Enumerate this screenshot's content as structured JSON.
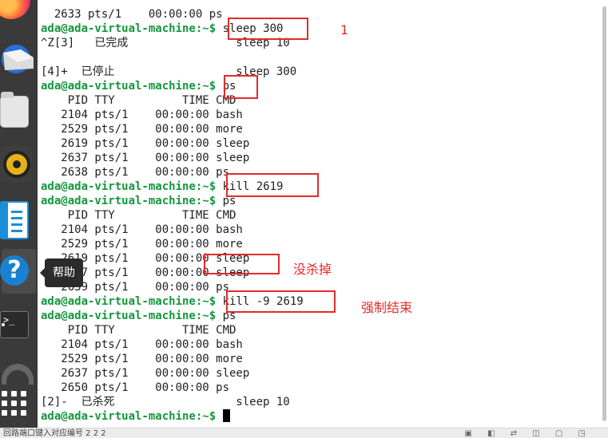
{
  "dock": {
    "tooltip": "帮助",
    "terminal_icon": ">_",
    "icons": [
      "firefox-icon",
      "thunderbird-mail-icon",
      "files-icon",
      "rhythmbox-icon",
      "libreoffice-writer-icon",
      "help-icon",
      "terminal-icon",
      "software-icon",
      "show-applications-icon"
    ]
  },
  "terminal": {
    "prompt": "ada@ada-virtual-machine:~$",
    "lines": [
      {
        "text": "  2633 pts/1    00:00:00 ps"
      },
      {
        "prompt": true,
        "text": " sleep 300"
      },
      {
        "text": "^Z[3]   已完成                sleep 10"
      },
      {
        "text": ""
      },
      {
        "text": "[4]+  已停止                  sleep 300"
      },
      {
        "prompt": true,
        "text": " ps"
      },
      {
        "text": "    PID TTY          TIME CMD"
      },
      {
        "text": "   2104 pts/1    00:00:00 bash"
      },
      {
        "text": "   2529 pts/1    00:00:00 more"
      },
      {
        "text": "   2619 pts/1    00:00:00 sleep"
      },
      {
        "text": "   2637 pts/1    00:00:00 sleep"
      },
      {
        "text": "   2638 pts/1    00:00:00 ps"
      },
      {
        "prompt": true,
        "text": " kill 2619"
      },
      {
        "prompt": true,
        "text": " ps"
      },
      {
        "text": "    PID TTY          TIME CMD"
      },
      {
        "text": "   2104 pts/1    00:00:00 bash"
      },
      {
        "text": "   2529 pts/1    00:00:00 more"
      },
      {
        "text": "   2619 pts/1    00:00:00 sleep"
      },
      {
        "text": "   2637 pts/1    00:00:00 sleep"
      },
      {
        "text": "   2639 pts/1    00:00:00 ps"
      },
      {
        "prompt": true,
        "text": " kill -9 2619"
      },
      {
        "prompt": true,
        "text": " ps"
      },
      {
        "text": "    PID TTY          TIME CMD"
      },
      {
        "text": "   2104 pts/1    00:00:00 bash"
      },
      {
        "text": "   2529 pts/1    00:00:00 more"
      },
      {
        "text": "   2637 pts/1    00:00:00 sleep"
      },
      {
        "text": "   2650 pts/1    00:00:00 ps"
      },
      {
        "text": "[2]-  已杀死                  sleep 10"
      },
      {
        "prompt": true,
        "text": " ",
        "cursor": true
      }
    ]
  },
  "annotations": {
    "label_1": "1",
    "not_killed": "没杀掉",
    "force_kill": "强制结束",
    "color": "#e52a2a"
  },
  "statusbar": {
    "text": "回路端口键入对应编号 2 2 2"
  },
  "colors": {
    "prompt": "#15963d",
    "dock": "#3a3a3a",
    "highlight": "#e52a2a"
  }
}
